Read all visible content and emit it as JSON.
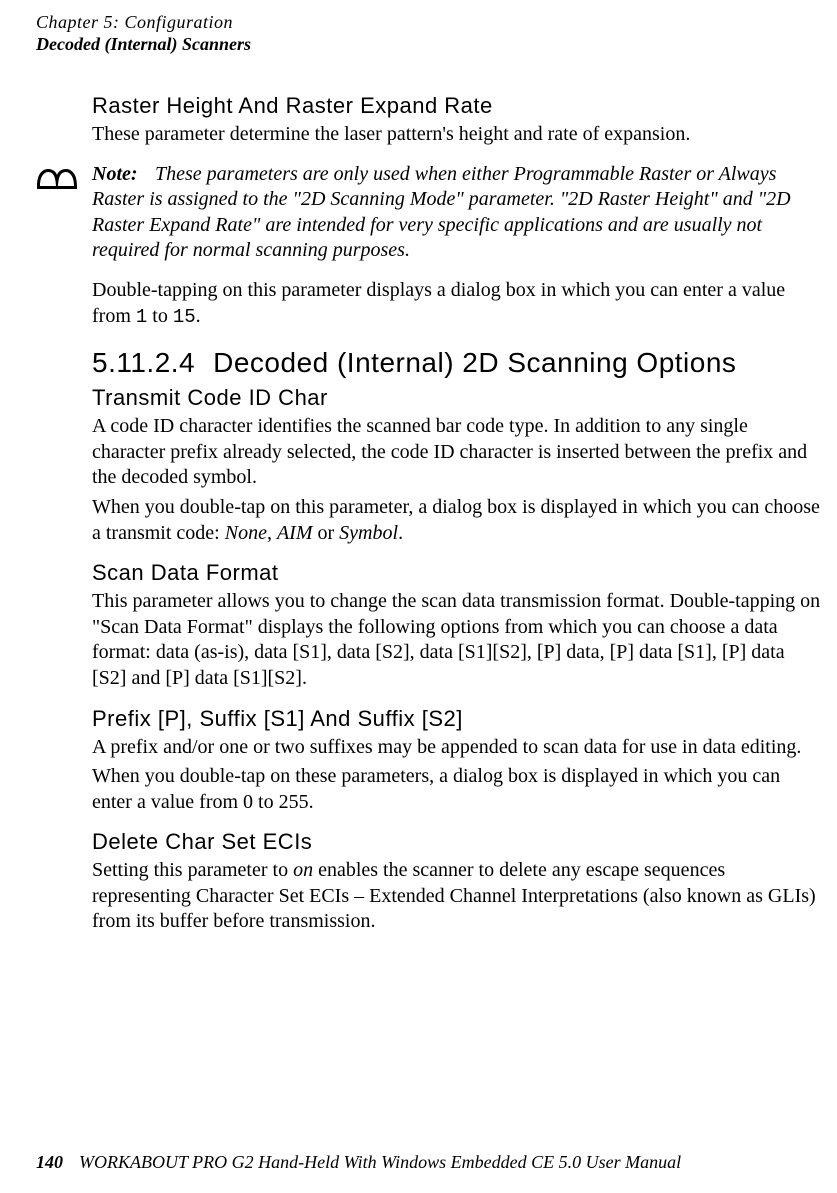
{
  "header": {
    "line1": "Chapter 5: Configuration",
    "line2": "Decoded (Internal) Scanners"
  },
  "sections": {
    "raster": {
      "title": "Raster Height And Raster Expand Rate",
      "p1": "These parameter determine the laser pattern's height and rate of expansion."
    },
    "note": {
      "label": "Note:",
      "line1": "These parameters are only used when either Programmable Raster or Always Raster is assigned to the \"2D Scanning Mode\" parameter. \"2D Raster Height\" and \"2D Raster Expand Rate\" are intended for very specific applications and are usually not required for normal scanning purposes."
    },
    "afterNote": {
      "pre": "Double-tapping on this parameter displays a dialog box in which you can enter a value from ",
      "v1": "1",
      "mid": " to ",
      "v2": "15",
      "post": "."
    },
    "h2": {
      "num": "5.11.2.4",
      "title": "Decoded (Internal) 2D Scanning Options"
    },
    "transmit": {
      "title": "Transmit Code ID Char",
      "p1": "A code ID character identifies the scanned bar code type. In addition to any single character prefix already selected, the code ID character is inserted between the prefix and the decoded symbol.",
      "p2a": "When you double-tap on this parameter, a dialog box is displayed in which you can choose a transmit code: ",
      "opt1": "None",
      "sep1": ", ",
      "opt2": "AIM",
      "sep2": " or ",
      "opt3": "Symbol",
      "end": "."
    },
    "scanData": {
      "title": "Scan Data Format",
      "p1": "This parameter allows you to change the scan data transmission format. Double-tapping on \"Scan Data Format\" displays the following options from which you can choose a data format: data (as-is), data [S1], data [S2], data [S1][S2], [P] data, [P] data [S1], [P] data [S2] and [P] data [S1][S2]."
    },
    "prefix": {
      "title": "Prefix [P], Suffix [S1] And Suffix [S2]",
      "p1": "A prefix and/or one or two suffixes may be appended to scan data for use in data editing.",
      "p2": "When you double-tap on these parameters, a dialog box is displayed in which you can enter a value from 0 to 255."
    },
    "delete": {
      "title": "Delete Char Set ECIs",
      "p1pre": "Setting this parameter to ",
      "p1it": "on",
      "p1post": " enables the scanner to delete any escape sequences representing Character Set ECIs – Extended Channel Interpretations (also known as GLIs) from its buffer before transmission."
    }
  },
  "footer": {
    "pageNumber": "140",
    "text": "WORKABOUT PRO G2 Hand-Held With Windows Embedded CE 5.0 User Manual"
  }
}
